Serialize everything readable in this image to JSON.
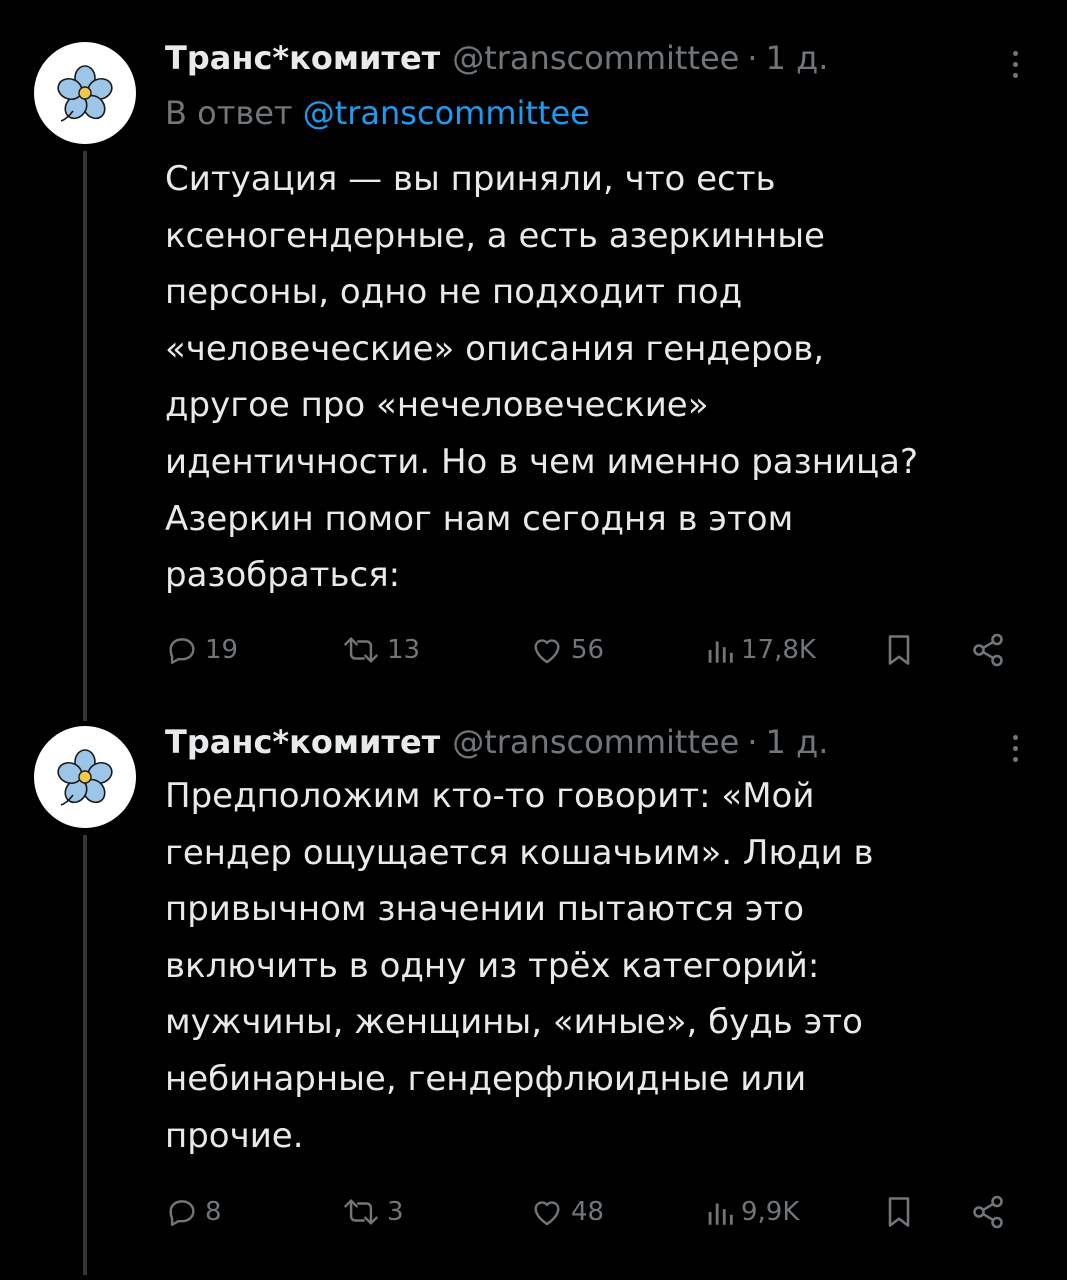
{
  "tweets": [
    {
      "name": "Транс*комитет",
      "handle": "@transcommittee",
      "separator": "·",
      "time": "1 д.",
      "reply_prefix": "В ответ",
      "reply_handle": "@transcommittee",
      "text": "Ситуация — вы приняли, что есть\nксеногендерные, а есть азеркинные\nперсоны, одно не подходит под\n«человеческие» описания гендеров,\nдругое про «нечеловеческие»\nидентичности. Но в чем именно разница?\nАзеркин помог нам сегодня в этом\nразобраться:",
      "replies": "19",
      "reposts": "13",
      "likes": "56",
      "views": "17,8K"
    },
    {
      "name": "Транс*комитет",
      "handle": "@transcommittee",
      "separator": "·",
      "time": "1 д.",
      "text": "Предположим кто-то говорит: «Мой\nгендер ощущается кошачьим». Люди в\nпривычном значении пытаются это\nвключить в одну из трёх категорий:\nмужчины, женщины, «иные», будь это\nнебинарные, гендерфлюидные или\nпрочие.",
      "replies": "8",
      "reposts": "3",
      "likes": "48",
      "views": "9,9K"
    }
  ],
  "icons": {
    "avatar": "forget-me-not-flower-icon",
    "reply": "reply-icon",
    "repost": "repost-icon",
    "like": "heart-icon",
    "views": "views-icon",
    "bookmark": "bookmark-icon",
    "share": "share-icon",
    "more": "more-icon"
  },
  "colors": {
    "background": "#000000",
    "text": "#e7e9ea",
    "secondary": "#71767b",
    "link": "#1d9bf0",
    "avatar_petal": "#9cc5e8"
  }
}
